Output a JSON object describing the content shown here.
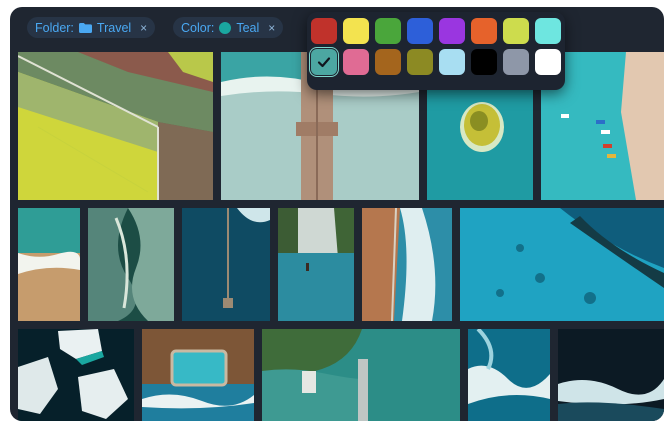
{
  "filters": {
    "folder": {
      "key": "Folder:",
      "value": "Travel",
      "icon": "folder-icon",
      "remove": "×"
    },
    "color": {
      "key": "Color:",
      "value": "Teal",
      "dot_color": "#1aa7a0",
      "remove": "×"
    }
  },
  "palette": {
    "swatches": [
      {
        "name": "red",
        "hex": "#c0322b",
        "selected": false
      },
      {
        "name": "yellow",
        "hex": "#f3e34f",
        "selected": false
      },
      {
        "name": "green",
        "hex": "#4aa63b",
        "selected": false
      },
      {
        "name": "blue",
        "hex": "#2d5fd9",
        "selected": false
      },
      {
        "name": "purple",
        "hex": "#9a36e0",
        "selected": false
      },
      {
        "name": "orange",
        "hex": "#e6622b",
        "selected": false
      },
      {
        "name": "lime",
        "hex": "#cddc4d",
        "selected": false
      },
      {
        "name": "aqua",
        "hex": "#6ee6e0",
        "selected": false
      },
      {
        "name": "teal",
        "hex": "#4ca7a2",
        "selected": true,
        "icon": "check-icon"
      },
      {
        "name": "pink",
        "hex": "#e06b94",
        "selected": false
      },
      {
        "name": "brown",
        "hex": "#a4651d",
        "selected": false
      },
      {
        "name": "olive",
        "hex": "#8c8a23",
        "selected": false
      },
      {
        "name": "light-blue",
        "hex": "#a8def2",
        "selected": false
      },
      {
        "name": "black",
        "hex": "#000000",
        "selected": false
      },
      {
        "name": "gray",
        "hex": "#8e97a8",
        "selected": false
      },
      {
        "name": "white",
        "hex": "#ffffff",
        "selected": false
      }
    ]
  },
  "gallery": {
    "photos": [
      {
        "id": "farmland-aerial"
      },
      {
        "id": "pier-beach"
      },
      {
        "id": "island-lagoon"
      },
      {
        "id": "beach-boats"
      },
      {
        "id": "sand-surf"
      },
      {
        "id": "green-coastline"
      },
      {
        "id": "ocean-dock"
      },
      {
        "id": "infinity-pool"
      },
      {
        "id": "coast-road"
      },
      {
        "id": "reef-lagoon"
      },
      {
        "id": "ice-floes"
      },
      {
        "id": "tidal-pool"
      },
      {
        "id": "forest-shore"
      },
      {
        "id": "surf-rocks"
      },
      {
        "id": "dark-waves"
      }
    ]
  }
}
